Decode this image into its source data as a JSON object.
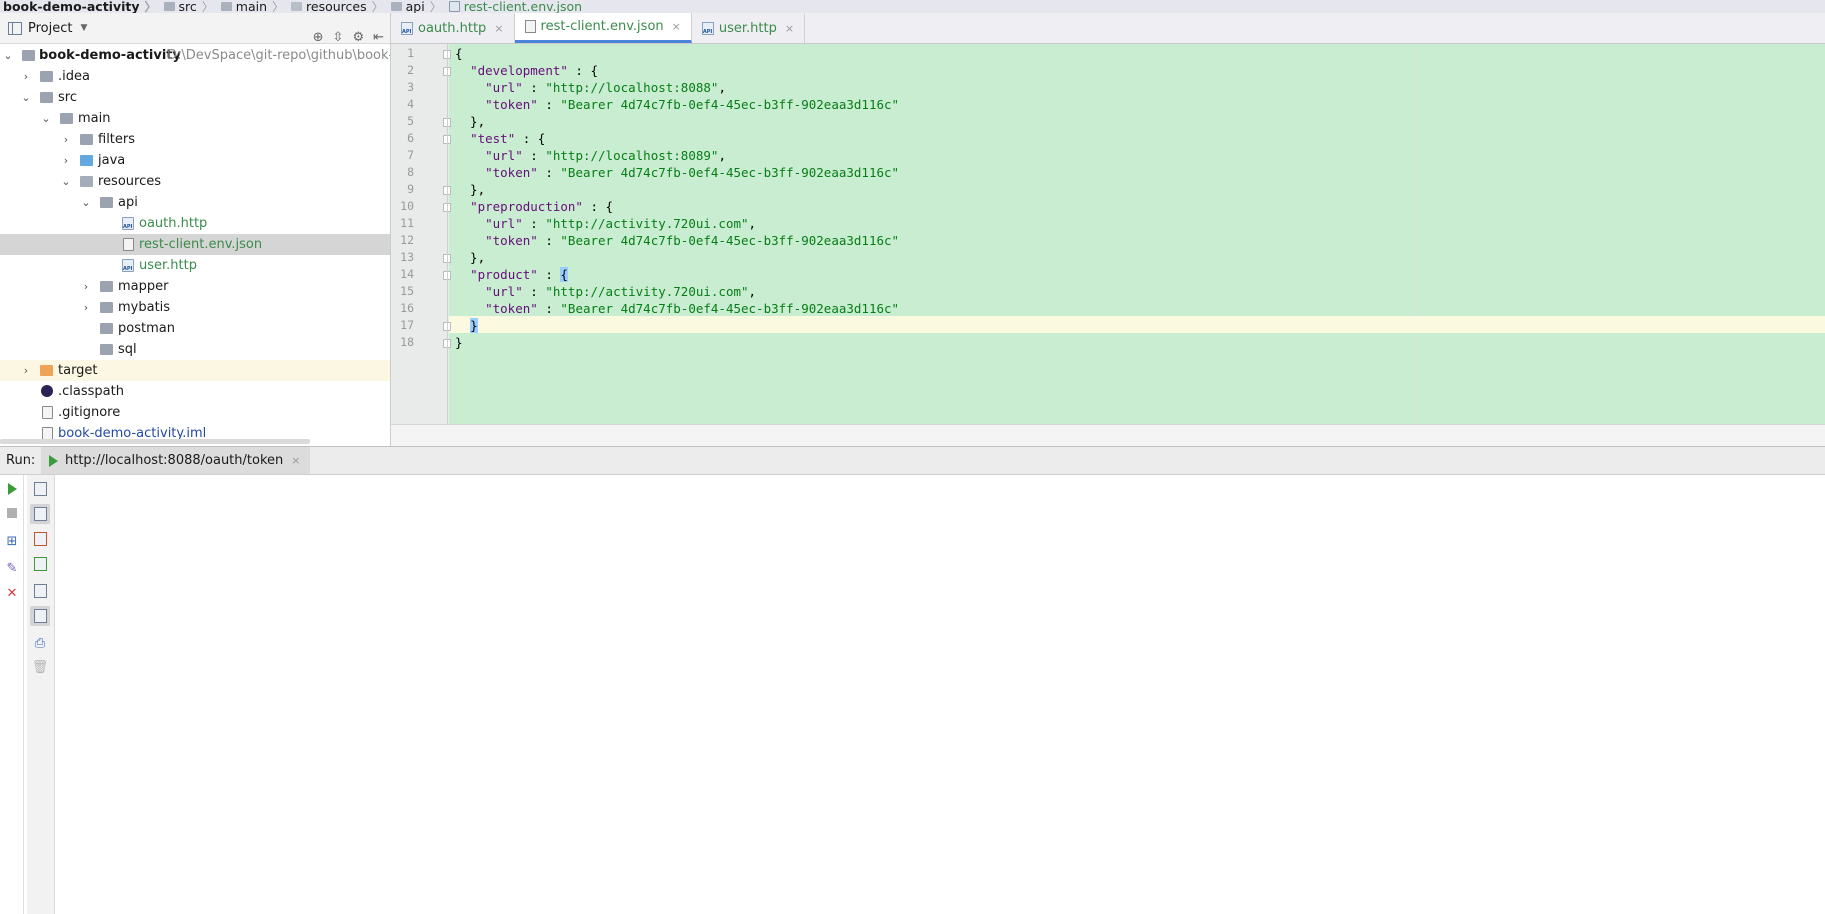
{
  "navbar": {
    "crumbs": [
      "book-demo-activity",
      "src",
      "main",
      "resources",
      "api",
      "rest-client.env.json"
    ]
  },
  "project_panel": {
    "title": "Project",
    "tree": [
      {
        "label": "book-demo-activity",
        "path": "D:\\DevSpace\\git-repo\\github\\book-de"
      },
      {
        "label": ".idea"
      },
      {
        "label": "src"
      },
      {
        "label": "main"
      },
      {
        "label": "filters"
      },
      {
        "label": "java"
      },
      {
        "label": "resources"
      },
      {
        "label": "api"
      },
      {
        "label": "oauth.http"
      },
      {
        "label": "rest-client.env.json"
      },
      {
        "label": "user.http"
      },
      {
        "label": "mapper"
      },
      {
        "label": "mybatis"
      },
      {
        "label": "postman"
      },
      {
        "label": "sql"
      },
      {
        "label": "target"
      },
      {
        "label": ".classpath"
      },
      {
        "label": ".gitignore"
      },
      {
        "label": "book-demo-activity.iml"
      }
    ]
  },
  "editor": {
    "tabs": [
      {
        "label": "oauth.http",
        "close": "×"
      },
      {
        "label": "rest-client.env.json",
        "close": "×"
      },
      {
        "label": "user.http",
        "close": "×"
      }
    ],
    "line_numbers": [
      "1",
      "2",
      "3",
      "4",
      "5",
      "6",
      "7",
      "8",
      "9",
      "10",
      "11",
      "12",
      "13",
      "14",
      "15",
      "16",
      "17",
      "18"
    ],
    "lines": [
      "{",
      "  \"development\" : {",
      "    \"url\" : \"http://localhost:8088\",",
      "    \"token\" : \"Bearer 4d74c7fb-0ef4-45ec-b3ff-902eaa3d116c\"",
      "  },",
      "  \"test\" : {",
      "    \"url\" : \"http://localhost:8089\",",
      "    \"token\" : \"Bearer 4d74c7fb-0ef4-45ec-b3ff-902eaa3d116c\"",
      "  },",
      "  \"preproduction\" : {",
      "    \"url\" : \"http://activity.720ui.com\",",
      "    \"token\" : \"Bearer 4d74c7fb-0ef4-45ec-b3ff-902eaa3d116c\"",
      "  },",
      "  \"product\" : {",
      "    \"url\" : \"http://activity.720ui.com\",",
      "    \"token\" : \"Bearer 4d74c7fb-0ef4-45ec-b3ff-902eaa3d116c\"",
      "  }",
      "}"
    ]
  },
  "run_panel": {
    "label": "Run:",
    "tab": "http://localhost:8088/oauth/token",
    "close": "×"
  },
  "icons": {
    "play": "run-play-icon",
    "stop": "stop-icon",
    "close": "close-icon",
    "gear": "gear-icon"
  },
  "colors": {
    "code_background": "#c9edd0",
    "string": "#067d17",
    "key": "#660e7a",
    "tab_text": "#3b8b4c"
  }
}
